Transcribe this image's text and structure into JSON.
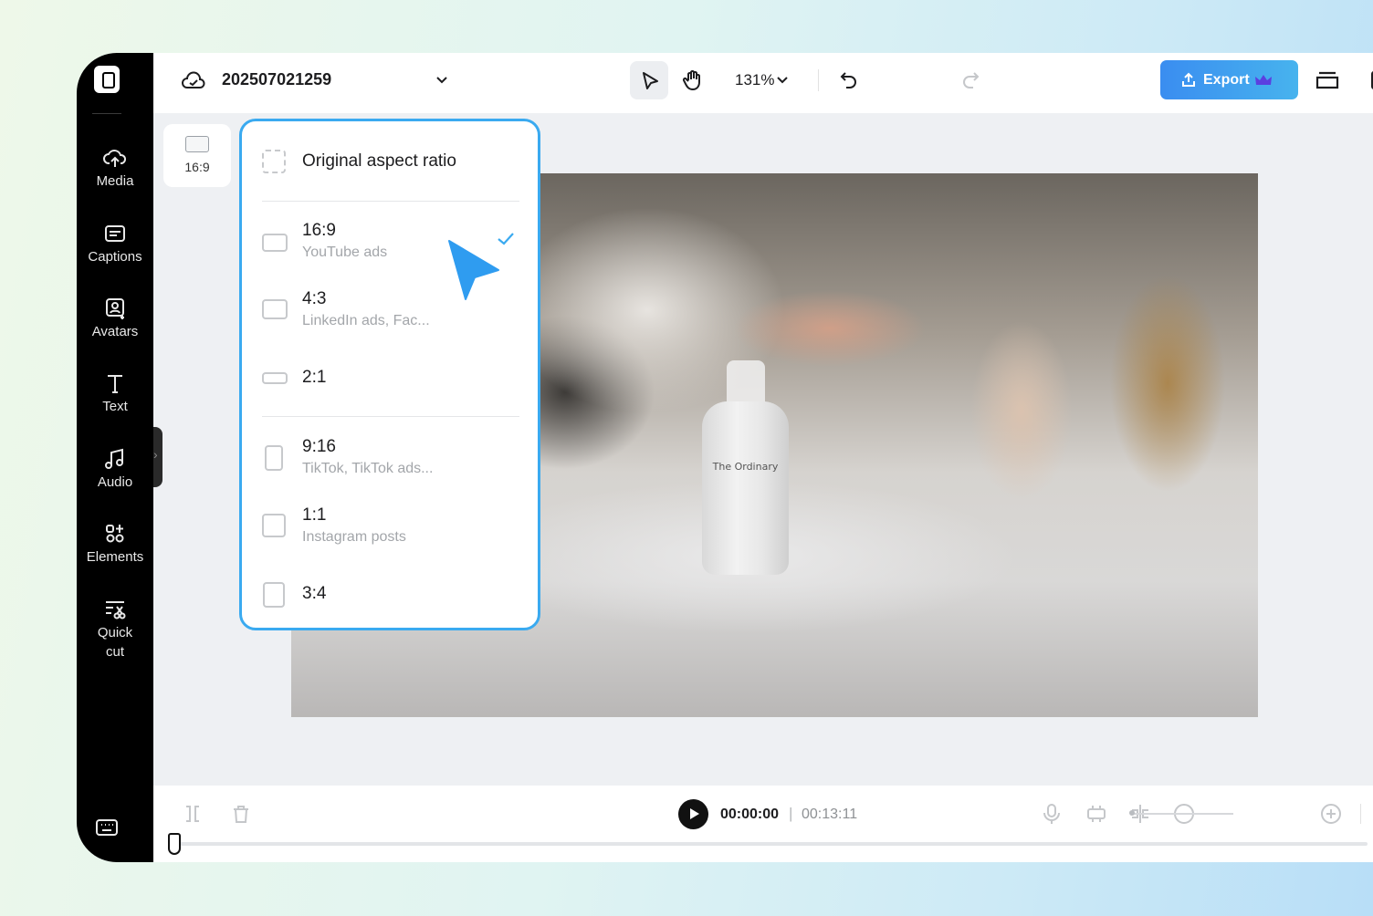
{
  "project": {
    "name": "202507021259"
  },
  "toolbar": {
    "zoom": "131%",
    "export_label": "Export"
  },
  "sidebar": {
    "items": [
      {
        "label": "Media",
        "icon": "cloud-upload-icon"
      },
      {
        "label": "Captions",
        "icon": "captions-icon"
      },
      {
        "label": "Avatars",
        "icon": "avatar-icon"
      },
      {
        "label": "Text",
        "icon": "text-icon"
      },
      {
        "label": "Audio",
        "icon": "music-note-icon"
      },
      {
        "label": "Elements",
        "icon": "elements-icon"
      },
      {
        "label_line1": "Quick",
        "label_line2": "cut",
        "icon": "quick-cut-icon"
      }
    ]
  },
  "canvas": {
    "current_ratio": "16:9"
  },
  "video": {
    "label_text": "The Ordinary"
  },
  "aspect_menu": {
    "original": "Original aspect ratio",
    "options": [
      {
        "ratio": "16:9",
        "desc": "YouTube ads",
        "selected": true
      },
      {
        "ratio": "4:3",
        "desc": "LinkedIn ads, Fac..."
      },
      {
        "ratio": "2:1",
        "desc": ""
      },
      {
        "ratio": "9:16",
        "desc": "TikTok, TikTok ads..."
      },
      {
        "ratio": "1:1",
        "desc": "Instagram posts"
      },
      {
        "ratio": "3:4",
        "desc": ""
      }
    ]
  },
  "player": {
    "current_time": "00:00:00",
    "separator": "|",
    "total_time": "00:13:11"
  },
  "colors": {
    "accent": "#3aaaf0",
    "export": "#3a8df0",
    "sidebar": "#000000"
  }
}
